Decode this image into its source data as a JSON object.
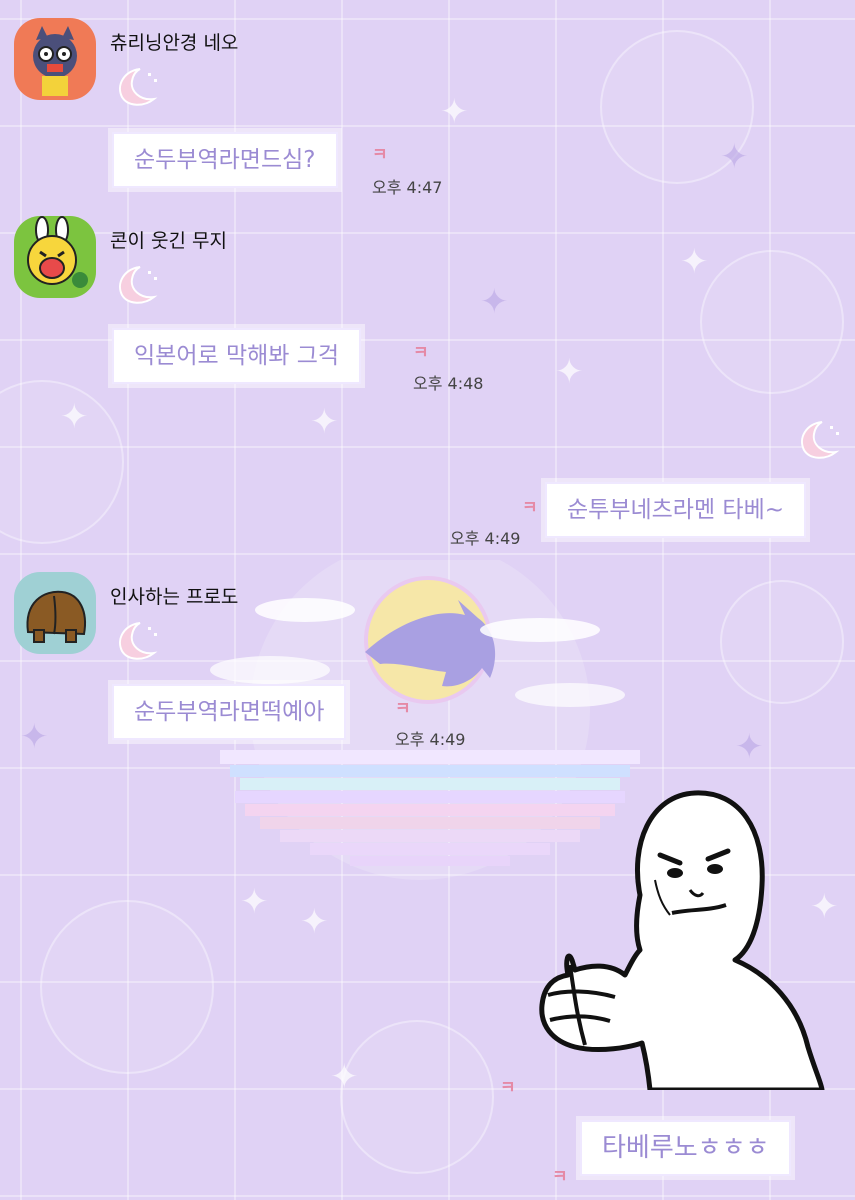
{
  "messages": [
    {
      "sender": "츄리닝안경 네오",
      "text": "순두부역라면드심?",
      "time": "오후 4:47",
      "read_mark": "ㅋ"
    },
    {
      "sender": "콘이 웃긴 무지",
      "text": "익본어로 막해봐 그걱",
      "time": "오후 4:48",
      "read_mark": "ㅋ"
    },
    {
      "sender": "",
      "text": "순투부네츠라멘 타베~",
      "time": "오후 4:49",
      "read_mark": "ㅋ"
    },
    {
      "sender": "인사하는 프로도",
      "text": "순두부역라면떡예아",
      "time": "오후 4:49",
      "read_mark": "ㅋ"
    },
    {
      "sender": "",
      "text": "타베루노ㅎㅎㅎ",
      "time": "",
      "read_mark": "ㅋ"
    }
  ],
  "sticker_read_mark": "ㅋ",
  "colors": {
    "bubble_text": "#9b8bd3",
    "background": "#e0d2f5",
    "read_mark": "#e58aa6"
  },
  "icons": [
    "neo-avatar-icon",
    "muzi-avatar-icon",
    "frodo-avatar-icon",
    "moon-icon",
    "thumbs-up-sticker"
  ]
}
